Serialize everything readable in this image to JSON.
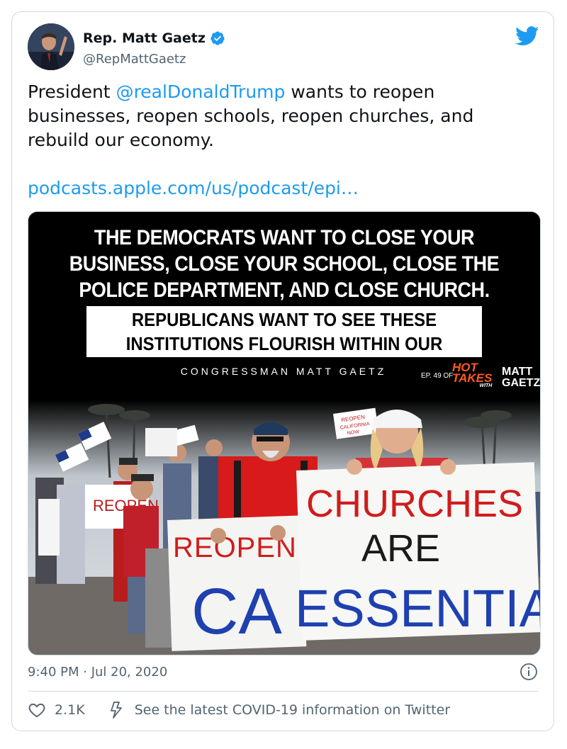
{
  "author": {
    "display_name": "Rep. Matt Gaetz",
    "handle": "@RepMattGaetz",
    "verified": true
  },
  "tweet": {
    "text_prefix": "President ",
    "mention": "@realDonaldTrump",
    "text_suffix": " wants to reopen businesses, reopen schools, reopen churches, and rebuild our economy.",
    "link": "podcasts.apple.com/us/podcast/epi…"
  },
  "media": {
    "quote_line1": "THE DEMOCRATS WANT TO CLOSE YOUR",
    "quote_line2": "BUSINESS, CLOSE YOUR SCHOOL, CLOSE THE",
    "quote_line3": "POLICE DEPARTMENT, AND CLOSE CHURCH.",
    "quote_sub1": "REPUBLICANS WANT TO SEE THESE",
    "quote_sub2": "INSTITUTIONS FLOURISH WITHIN OUR SOCIETY.",
    "attribution": "CONGRESSMAN MATT GAETZ",
    "episode": "EP. 49 OF",
    "hot_takes_1": "HOT",
    "hot_takes_2": "TAKES",
    "with_label": "WITH",
    "brand_1": "MATT",
    "brand_2": "GAETZ",
    "sign_reopen_small": "REOPEN",
    "sign_reopen": "REOPEN",
    "sign_ca": "CA",
    "sign_churches": "CHURCHES",
    "sign_are": "ARE",
    "sign_essential": "ESSENTIAL",
    "sign_back_1": "REOPEN",
    "sign_back_2": "CALIFORNIA",
    "sign_back_3": "NOW"
  },
  "meta": {
    "timestamp": "9:40 PM · Jul 20, 2020",
    "likes": "2.1K",
    "covid_notice": "See the latest COVID-19 information on Twitter"
  },
  "colors": {
    "accent": "#1d9bf0",
    "secondary_text": "#536471",
    "hot_takes": "#ff5a1f"
  },
  "icons": [
    "verified-badge-icon",
    "twitter-bird-icon",
    "info-icon",
    "heart-icon",
    "lightning-bolt-icon"
  ]
}
